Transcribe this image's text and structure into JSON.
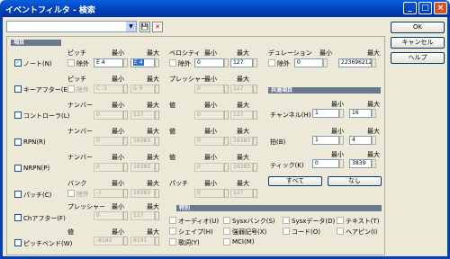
{
  "window": {
    "title": "イベントフィルタ - 検索",
    "min": "_",
    "max": "□",
    "close": "×"
  },
  "toolbar": {
    "arrow": "▼",
    "save": "💾",
    "del": "✕"
  },
  "dialog": {
    "ok": "OK",
    "cancel": "キャンセル",
    "help": "ヘルプ"
  },
  "items": {
    "header": "項目",
    "note": {
      "label": "ノート(N)",
      "pitch": "ピッチ",
      "exclude": "除外",
      "min_h": "最小",
      "max_h": "最大",
      "pitch_min": "E 4",
      "pitch_max": "E 4",
      "velocity": "ベロシティ",
      "vel_min_h": "最小",
      "vel_max_h": "最大",
      "vel_min": "0",
      "vel_max": "127",
      "duration": "デュレーション",
      "dur_min_h": "最小",
      "dur_max_h": "最大",
      "dur_min": "0",
      "dur_max": "223696212"
    },
    "keyaft": {
      "label": "キーアフター(E)",
      "pitch": "ピッチ",
      "exclude": "除外",
      "min_h": "最小",
      "max_h": "最大",
      "p_min": "C -1",
      "p_max": "G 9",
      "pressure": "プレッシャー",
      "pr_min_h": "最小",
      "pr_max_h": "最大",
      "pr_min": "0",
      "pr_max": "127"
    },
    "control": {
      "label": "コントローラ(L)",
      "number": "ナンバー",
      "min_h": "最小",
      "max_h": "最大",
      "n_min": "0",
      "n_max": "127",
      "value": "値",
      "v_min_h": "最小",
      "v_max_h": "最大",
      "v_min": "0",
      "v_max": "127"
    },
    "rpn": {
      "label": "RPN(R)",
      "number": "ナンバー",
      "min_h": "最小",
      "max_h": "最大",
      "n_min": "0",
      "n_max": "16383",
      "value": "値",
      "v_min_h": "最小",
      "v_max_h": "最大",
      "v_min": "0",
      "v_max": "16383"
    },
    "nrpn": {
      "label": "NRPN(P)",
      "number": "ナンバー",
      "min_h": "最小",
      "max_h": "最大",
      "n_min": "0",
      "n_max": "16383",
      "value": "値",
      "v_min_h": "最小",
      "v_max_h": "最大",
      "v_min": "0",
      "v_max": "16383"
    },
    "patch": {
      "label": "パッチ(C)",
      "bank": "バンク",
      "exclude": "除外",
      "min_h": "最小",
      "max_h": "最大",
      "b_min": "-1",
      "b_max": "16383",
      "patch": "パッチ",
      "p_min_h": "最小",
      "p_max_h": "最大",
      "p_min": "0",
      "p_max": "127"
    },
    "chaft": {
      "label": "Chアフター(F)",
      "pressure": "プレッシャー",
      "min_h": "最小",
      "max_h": "最大",
      "p_min": "0",
      "p_max": "127"
    },
    "bend": {
      "label": "ピッチベンド(W)",
      "value": "値",
      "min_h": "最小",
      "max_h": "最大",
      "v_min": "-8192",
      "v_max": "8191"
    }
  },
  "common": {
    "header": "共通項目",
    "channel": "チャンネル(H)",
    "ch_min_h": "最小",
    "ch_max_h": "最大",
    "ch_min": "1",
    "ch_max": "16",
    "beat": "拍(B)",
    "bt_min_h": "最小",
    "bt_max_h": "最大",
    "bt_min": "1",
    "bt_max": "4",
    "tick": "ティック(K)",
    "tk_min_h": "最小",
    "tk_max_h": "最大",
    "tk_min": "0",
    "tk_max": "3839",
    "all": "すべて",
    "none": "なし"
  },
  "special": {
    "header": "特別",
    "audio": "オーディオ(U)",
    "sysxbank": "Sysxバンク(S)",
    "sysxdata": "Sysxデータ(D)",
    "text": "テキスト(T)",
    "shape": "シェイプ(H)",
    "expr": "強弱記号(X)",
    "chord": "コード(O)",
    "hairpin": "ヘアピン(I)",
    "lyric": "歌詞(Y)",
    "mci": "MCI(M)"
  }
}
